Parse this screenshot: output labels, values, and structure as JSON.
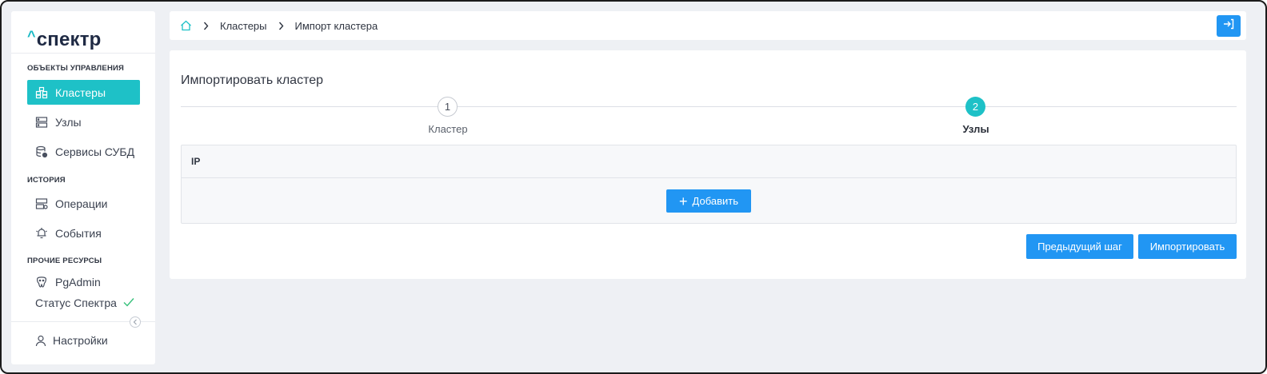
{
  "app": {
    "logo_caret": "^",
    "logo_text": "спектр"
  },
  "sidebar": {
    "sections": [
      {
        "title": "ОБЪЕКТЫ УПРАВЛЕНИЯ"
      },
      {
        "title": "ИСТОРИЯ"
      },
      {
        "title": "ПРОЧИЕ РЕСУРСЫ"
      }
    ],
    "items": [
      {
        "label": "Кластеры",
        "icon": "clusters-icon",
        "active": true
      },
      {
        "label": "Узлы",
        "icon": "nodes-icon",
        "active": false
      },
      {
        "label": "Сервисы СУБД",
        "icon": "dbms-services-icon",
        "active": false
      },
      {
        "label": "Операции",
        "icon": "operations-icon",
        "active": false
      },
      {
        "label": "События",
        "icon": "events-icon",
        "active": false
      },
      {
        "label": "PgAdmin",
        "icon": "pgadmin-icon",
        "active": false
      }
    ],
    "status": {
      "label": "Статус Спектра",
      "icon": "check-icon"
    },
    "settings": {
      "label": "Настройки",
      "icon": "user-icon"
    }
  },
  "breadcrumb": {
    "items": [
      "Кластеры",
      "Импорт кластера"
    ]
  },
  "main": {
    "title": "Импортировать кластер",
    "steps": [
      {
        "number": "1",
        "label": "Кластер",
        "state": "pending"
      },
      {
        "number": "2",
        "label": "Узлы",
        "state": "current"
      }
    ],
    "table": {
      "column_header": "IP",
      "add_label": "Добавить"
    },
    "actions": {
      "prev_label": "Предыдущий шаг",
      "import_label": "Импортировать"
    }
  },
  "colors": {
    "accent": "#1ec1c7",
    "primary": "#2196f3",
    "background": "#eef0f4"
  }
}
